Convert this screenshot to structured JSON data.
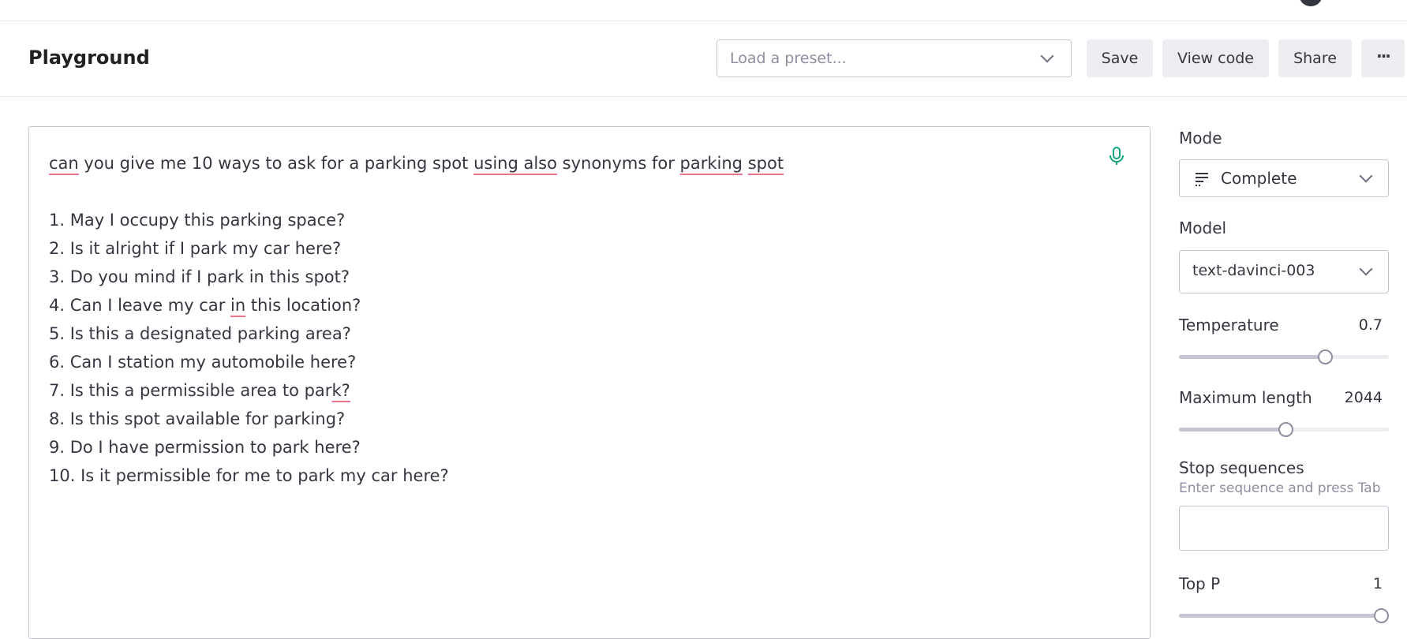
{
  "header": {
    "title": "Playground",
    "preset_placeholder": "Load a preset...",
    "save_label": "Save",
    "view_code_label": "View code",
    "share_label": "Share",
    "more_label": "···"
  },
  "editor": {
    "prompt_parts": [
      "can",
      " you give me 10 ways to ask for a parking spot ",
      "using also",
      " synonyms for ",
      "parking",
      " ",
      "spot"
    ],
    "lines": [
      "1. May I occupy this parking space?",
      "2. Is it alright if I park my car here?",
      "3. Do you mind if I park in this spot?",
      "4. Can I leave my car ",
      "5. Is this a designated parking area?",
      "6. Can I station my automobile here?",
      "7. Is this a permissible area to par",
      "8. Is this spot available for parking?",
      "9. Do I have permission to park here?",
      "10. Is it permissible for me to park my car here?"
    ],
    "line4_mid": "in",
    "line4_end": " this location?",
    "line7_end": "k?"
  },
  "settings": {
    "mode_label": "Mode",
    "mode_value": "Complete",
    "model_label": "Model",
    "model_value": "text-davinci-003",
    "temperature_label": "Temperature",
    "temperature_value": "0.7",
    "temperature_fraction": 0.7,
    "max_length_label": "Maximum length",
    "max_length_value": "2044",
    "max_length_fraction": 0.51,
    "stop_label": "Stop sequences",
    "stop_hint": "Enter sequence and press Tab",
    "top_p_label": "Top P",
    "top_p_value": "1",
    "top_p_fraction": 1.0
  },
  "colors": {
    "accent": "#10a37f",
    "spell_underline": "#e9738a",
    "button_bg": "#ececf1"
  }
}
